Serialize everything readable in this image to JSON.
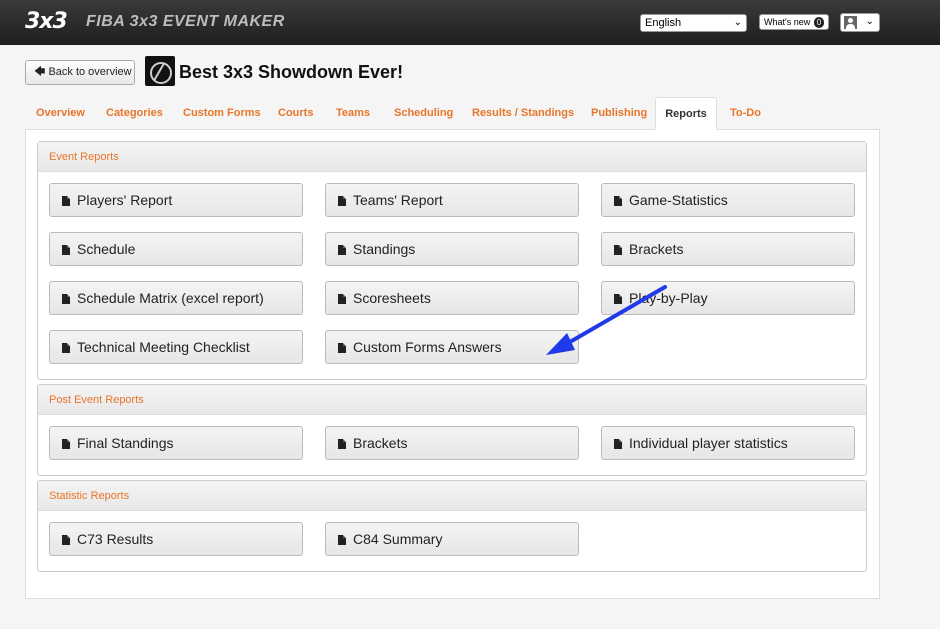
{
  "topbar": {
    "logo": "3x3",
    "app_title": "FIBA 3x3 EVENT MAKER",
    "language": "English",
    "whats_new_label": "What's new",
    "whats_new_count": "0"
  },
  "header": {
    "back_label": "Back to overview",
    "event_title": "Best 3x3 Showdown Ever!"
  },
  "tabs": [
    {
      "label": "Overview"
    },
    {
      "label": "Categories"
    },
    {
      "label": "Custom Forms"
    },
    {
      "label": "Courts"
    },
    {
      "label": "Teams"
    },
    {
      "label": "Scheduling"
    },
    {
      "label": "Results / Standings"
    },
    {
      "label": "Publishing"
    },
    {
      "label": "Reports",
      "active": true
    },
    {
      "label": "To-Do"
    }
  ],
  "sections": [
    {
      "title": "Event Reports",
      "items": [
        "Players' Report",
        "Teams' Report",
        "Game-Statistics",
        "Schedule",
        "Standings",
        "Brackets",
        "Schedule Matrix (excel report)",
        "Scoresheets",
        "Play-by-Play",
        "Technical Meeting Checklist",
        "Custom Forms Answers"
      ]
    },
    {
      "title": "Post Event Reports",
      "items": [
        "Final Standings",
        "Brackets",
        "Individual player statistics"
      ]
    },
    {
      "title": "Statistic Reports",
      "items": [
        "C73 Results",
        "C84 Summary"
      ]
    }
  ],
  "colors": {
    "accent": "#e8752a",
    "annotation_arrow": "#1f3ae8"
  }
}
